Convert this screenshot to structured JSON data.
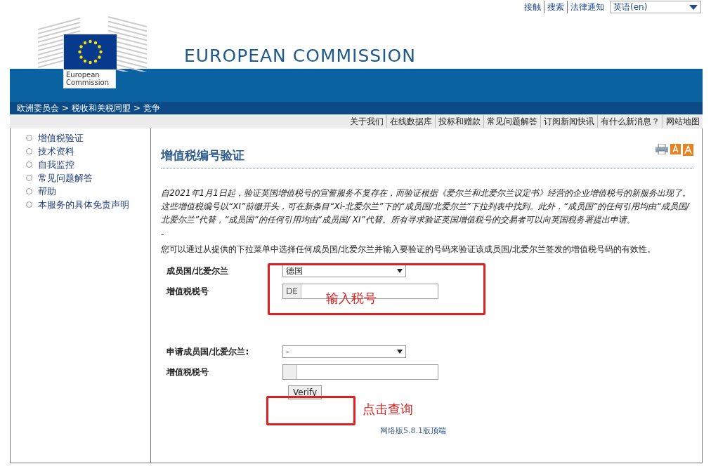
{
  "top_links": [
    "接触",
    "搜索",
    "法律通知"
  ],
  "language_select": {
    "value": "英语(en)"
  },
  "header": {
    "title": "EUROPEAN COMMISSION",
    "logo_text": "European Commission"
  },
  "breadcrumb": {
    "separator": ">",
    "items": [
      "欧洲委员会",
      "税收和关税同盟",
      "竞争"
    ]
  },
  "nav": [
    "关于我们",
    "在线数据库",
    "投标和赠款",
    "常见问题解答",
    "订阅新闻快讯",
    "有什么新消息？",
    "网站地图"
  ],
  "sidebar": [
    "增值税验证",
    "技术资料",
    "自我监控",
    "常见问题解答",
    "帮助",
    "本服务的具体免责声明"
  ],
  "page": {
    "title": "增值税编号验证",
    "notice": "自2021年1月1日起，验证英国增值税号的宣誓服务不复存在，而验证根据《爱尔兰和北爱尔兰议定书》经营的企业增值税号的新服务出现了。这些增值税编号以“XI”前缀开头，可在新条目“Xi-北爱尔兰”下的“成员国/北爱尔兰”下拉列表中找到。此外，“成员国”的任何引用均由“成员国/北爱尔兰”代替，“成员国”的任何引用均由“成员国/ XI”代替。所有寻求验证英国增值税号的交易者可以向英国税务署提出申请。",
    "dash": "-",
    "intro": "您可以通过从提供的下拉菜单中选择任何成员国/北爱尔兰并输入要验证的号码来验证该成员国/北爱尔兰签发的增值税号码的有效性。"
  },
  "form": {
    "rows": [
      {
        "kind": "select",
        "label": "成员国/北爱尔兰",
        "value": "德国"
      },
      {
        "kind": "vat",
        "label": "增值税税号",
        "prefix": "DE"
      },
      {
        "kind": "select",
        "label": "申请成员国/北爱尔兰:",
        "value": "-"
      },
      {
        "kind": "vat",
        "label": "增值税税号"
      }
    ],
    "button": "Verify"
  },
  "annotations": {
    "input_hint": "输入税号",
    "click_hint": "点击查询"
  },
  "footer": {
    "version": "网络版5.8.1版",
    "top_link": "顶端"
  }
}
